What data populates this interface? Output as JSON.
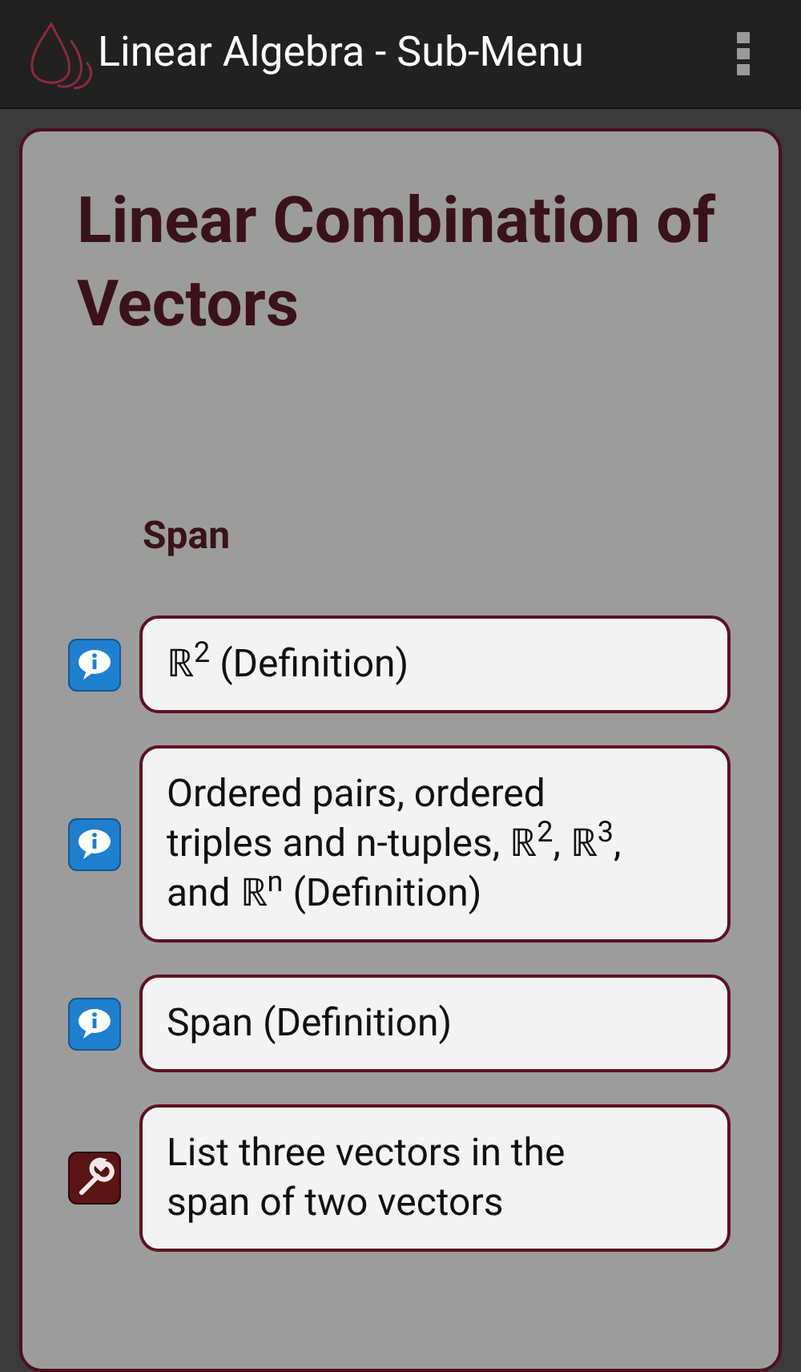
{
  "app_bar": {
    "title": "Linear Algebra - Sub-Menu"
  },
  "card": {
    "title": "Linear Combination of Vectors",
    "section": "Span",
    "items": [
      {
        "kind": "definition",
        "text": "ℝ$^{2}$ (Definition)"
      },
      {
        "kind": "definition",
        "text": "Ordered pairs, ordered triples and n-tuples, ℝ$^{2}$, ℝ$^{3}$, and ℝ$^{n}$ (Definition)"
      },
      {
        "kind": "definition",
        "text": "Span (Definition)"
      },
      {
        "kind": "exercise",
        "text": "List three vectors in the span of two vectors"
      }
    ]
  }
}
